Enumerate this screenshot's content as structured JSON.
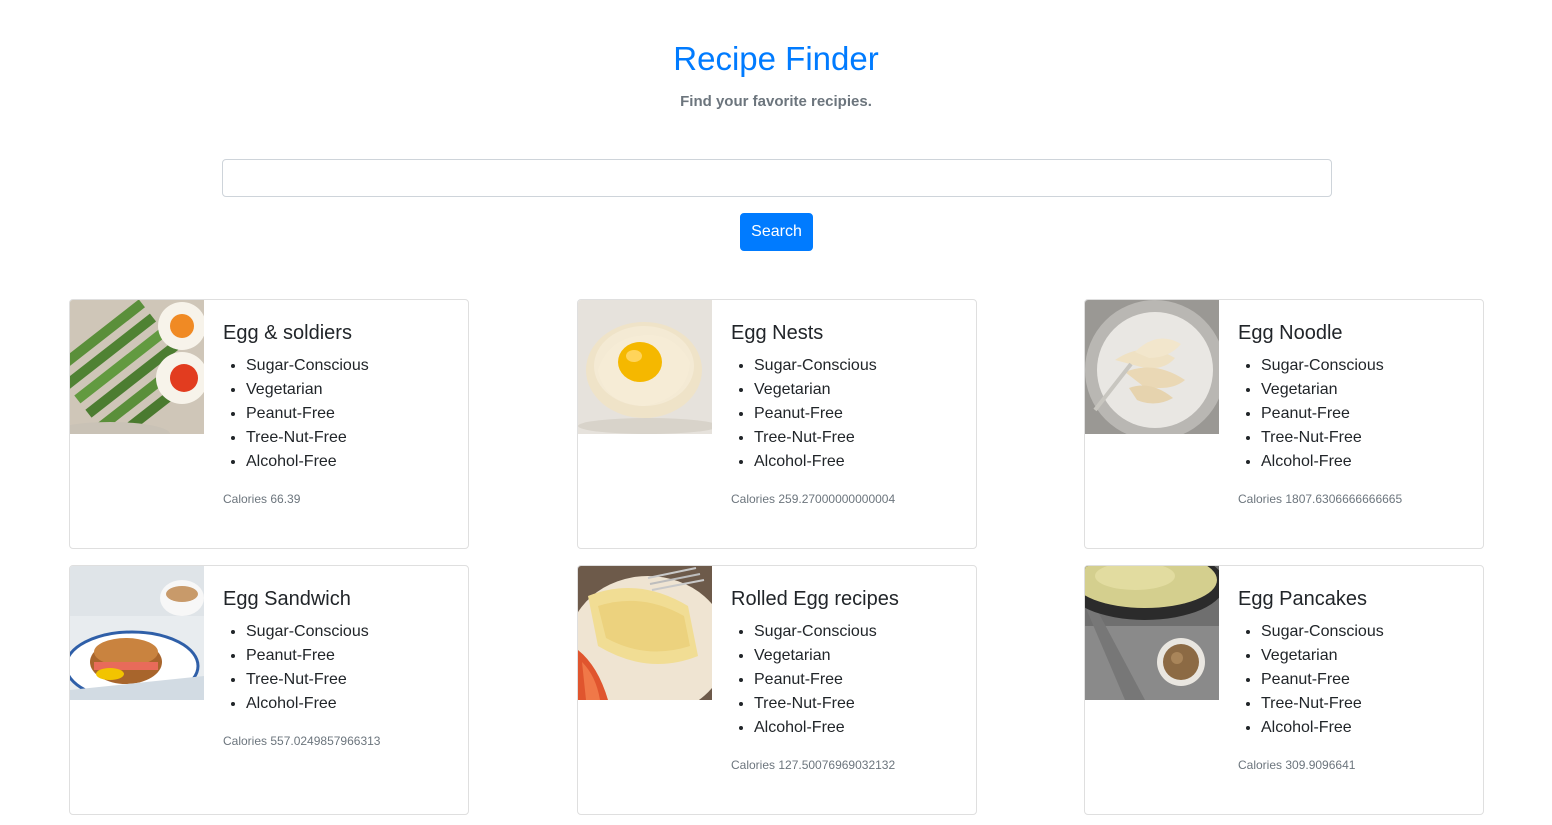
{
  "header": {
    "title": "Recipe Finder",
    "subtitle": "Find your favorite recipies."
  },
  "search": {
    "value": "",
    "placeholder": "",
    "button_label": "Search"
  },
  "colors": {
    "accent": "#007bff",
    "muted": "#6c757d"
  },
  "recipes": [
    {
      "title": "Egg & soldiers",
      "labels": [
        "Sugar-Conscious",
        "Vegetarian",
        "Peanut-Free",
        "Tree-Nut-Free",
        "Alcohol-Free"
      ],
      "calories": "Calories 66.39",
      "image": "asparagus-soft-boiled-eggs"
    },
    {
      "title": "Egg Nests",
      "labels": [
        "Sugar-Conscious",
        "Vegetarian",
        "Peanut-Free",
        "Tree-Nut-Free",
        "Alcohol-Free"
      ],
      "calories": "Calories 259.27000000000004",
      "image": "cloud-egg-nest"
    },
    {
      "title": "Egg Noodle",
      "labels": [
        "Sugar-Conscious",
        "Vegetarian",
        "Peanut-Free",
        "Tree-Nut-Free",
        "Alcohol-Free"
      ],
      "calories": "Calories 1807.6306666666665",
      "image": "noodle-plate"
    },
    {
      "title": "Egg Sandwich",
      "labels": [
        "Sugar-Conscious",
        "Peanut-Free",
        "Tree-Nut-Free",
        "Alcohol-Free"
      ],
      "calories": "Calories 557.0249857966313",
      "image": "egg-muffin-sandwich"
    },
    {
      "title": "Rolled Egg recipes",
      "labels": [
        "Sugar-Conscious",
        "Vegetarian",
        "Peanut-Free",
        "Tree-Nut-Free",
        "Alcohol-Free"
      ],
      "calories": "Calories 127.50076969032132",
      "image": "rolled-omelette"
    },
    {
      "title": "Egg Pancakes",
      "labels": [
        "Sugar-Conscious",
        "Vegetarian",
        "Peanut-Free",
        "Tree-Nut-Free",
        "Alcohol-Free"
      ],
      "calories": "Calories 309.9096641",
      "image": "pancake-skillet"
    }
  ]
}
